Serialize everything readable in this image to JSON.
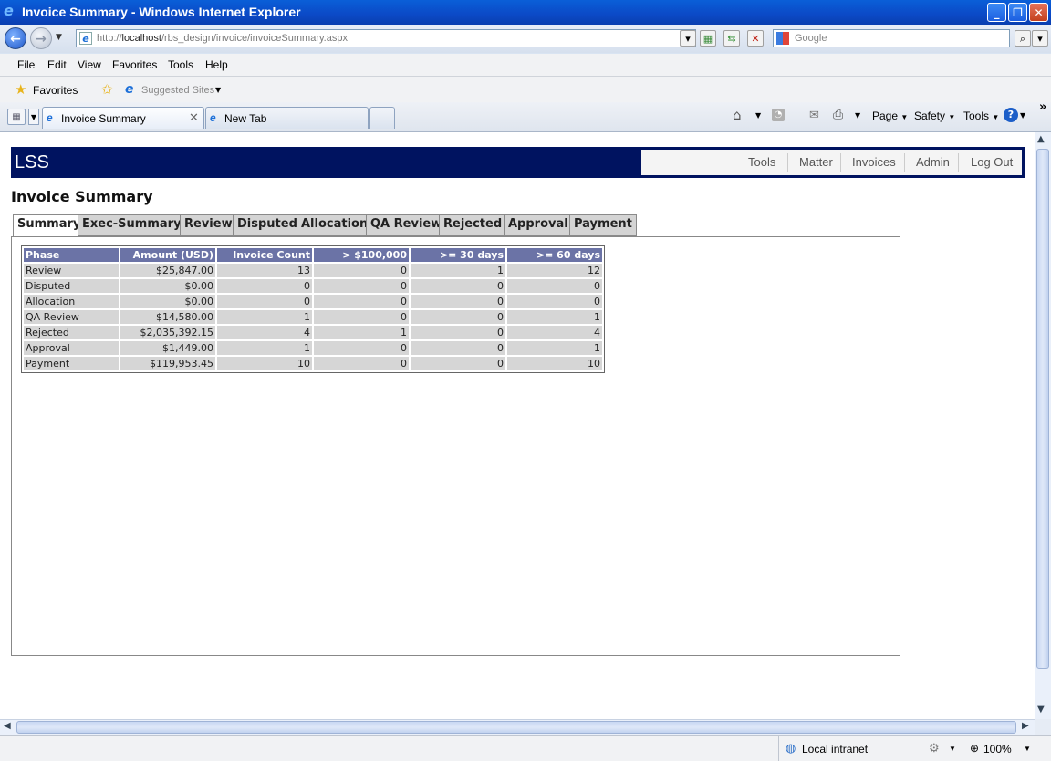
{
  "window": {
    "title": "Invoice Summary - Windows Internet Explorer"
  },
  "address": {
    "url_prefix": "http://",
    "url_host": "localhost",
    "url_path": "/rbs_design/invoice/invoiceSummary.aspx"
  },
  "search": {
    "placeholder": "Google"
  },
  "menu": [
    "File",
    "Edit",
    "View",
    "Favorites",
    "Tools",
    "Help"
  ],
  "favorites": {
    "label": "Favorites",
    "suggested": "Suggested Sites"
  },
  "browser_tabs": [
    {
      "label": "Invoice Summary"
    },
    {
      "label": "New Tab"
    }
  ],
  "command_bar": {
    "page": "Page",
    "safety": "Safety",
    "tools": "Tools"
  },
  "status": {
    "zone": "Local intranet",
    "zoom": "100%"
  },
  "app": {
    "logo": "LSS",
    "nav": [
      "Tools",
      "Matter",
      "Invoices",
      "Admin",
      "Log Out"
    ],
    "page_title": "Invoice Summary",
    "tabs": [
      "Summary",
      "Exec-Summary",
      "Review",
      "Disputed",
      "Allocation",
      "QA Review",
      "Rejected",
      "Approval",
      "Payment"
    ],
    "active_tab": "Summary"
  },
  "table": {
    "headers": [
      "Phase",
      "Amount (USD)",
      "Invoice Count",
      "> $100,000",
      ">= 30 days",
      ">= 60 days"
    ],
    "rows": [
      [
        "Review",
        "$25,847.00",
        "13",
        "0",
        "1",
        "12"
      ],
      [
        "Disputed",
        "$0.00",
        "0",
        "0",
        "0",
        "0"
      ],
      [
        "Allocation",
        "$0.00",
        "0",
        "0",
        "0",
        "0"
      ],
      [
        "QA Review",
        "$14,580.00",
        "1",
        "0",
        "0",
        "1"
      ],
      [
        "Rejected",
        "$2,035,392.15",
        "4",
        "1",
        "0",
        "4"
      ],
      [
        "Approval",
        "$1,449.00",
        "1",
        "0",
        "0",
        "1"
      ],
      [
        "Payment",
        "$119,953.45",
        "10",
        "0",
        "0",
        "10"
      ]
    ]
  },
  "colors": {
    "header_bg": "#001360",
    "grid_header": "#6b73a6",
    "grid_cell": "#d6d6d6"
  }
}
